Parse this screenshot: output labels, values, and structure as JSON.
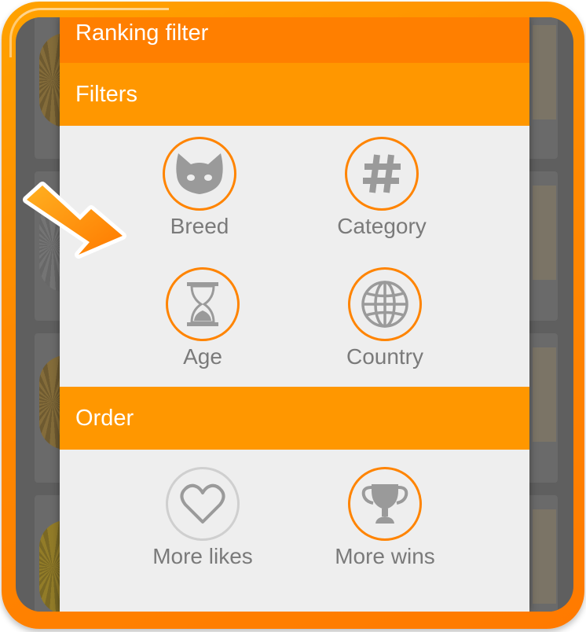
{
  "dialog": {
    "title": "Ranking filter",
    "filters_heading": "Filters",
    "order_heading": "Order"
  },
  "filters": [
    {
      "label": "Breed",
      "icon": "cat-icon",
      "active": true
    },
    {
      "label": "Category",
      "icon": "hashtag-icon",
      "active": true
    },
    {
      "label": "Age",
      "icon": "hourglass-icon",
      "active": true
    },
    {
      "label": "Country",
      "icon": "globe-icon",
      "active": true
    }
  ],
  "order": [
    {
      "label": "More likes",
      "icon": "heart-icon",
      "active": false
    },
    {
      "label": "More wins",
      "icon": "trophy-icon",
      "active": true
    }
  ],
  "colors": {
    "accent_dark": "#ff7f00",
    "accent": "#ff9700",
    "icon_gray": "#9a9a9a",
    "label_gray": "#7a7a7a",
    "dialog_bg": "#eeeeee"
  }
}
